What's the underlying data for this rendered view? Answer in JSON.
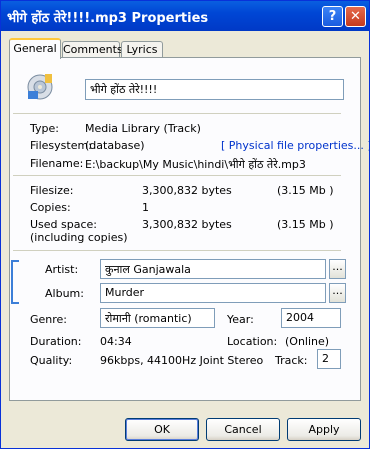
{
  "window": {
    "title": "भीगे होंठ तेरे!!!!.mp3 Properties",
    "help_label": "?",
    "close_label": "✕"
  },
  "tabs": [
    {
      "label": "General"
    },
    {
      "label": "Comments"
    },
    {
      "label": "Lyrics"
    }
  ],
  "general": {
    "name_value": "भीगे होंठ तेरे!!!!",
    "type_label": "Type:",
    "type_value": "Media Library (Track)",
    "filesystem_label": "Filesystem:",
    "filesystem_value": "(database)",
    "physical_link": "[ Physical file properties... ]",
    "filename_label": "Filename:",
    "filename_value": "E:\\backup\\My Music\\hindi\\भीगे होंठ तेरे.mp3",
    "filesize_label": "Filesize:",
    "filesize_bytes": "3,300,832 bytes",
    "filesize_mb": "(3.15 Mb )",
    "copies_label": "Copies:",
    "copies_value": "1",
    "used_label": "Used space:",
    "used_sub_label": "(including copies)",
    "used_bytes": "3,300,832 bytes",
    "used_mb": "(3.15 Mb )",
    "artist_label": "Artist:",
    "artist_value": "कुनाल  Ganjawala",
    "album_label": "Album:",
    "album_value": "Murder",
    "browse_label": "...",
    "genre_label": "Genre:",
    "genre_value": "रोमानी (romantic)",
    "year_label": "Year:",
    "year_value": "2004",
    "duration_label": "Duration:",
    "duration_value": "04:34",
    "location_label": "Location:",
    "location_value": "(Online)",
    "quality_label": "Quality:",
    "quality_value": "96kbps, 44100Hz Joint Stereo",
    "track_label": "Track:",
    "track_value": "2"
  },
  "buttons": {
    "ok": "OK",
    "cancel": "Cancel",
    "apply": "Apply"
  }
}
